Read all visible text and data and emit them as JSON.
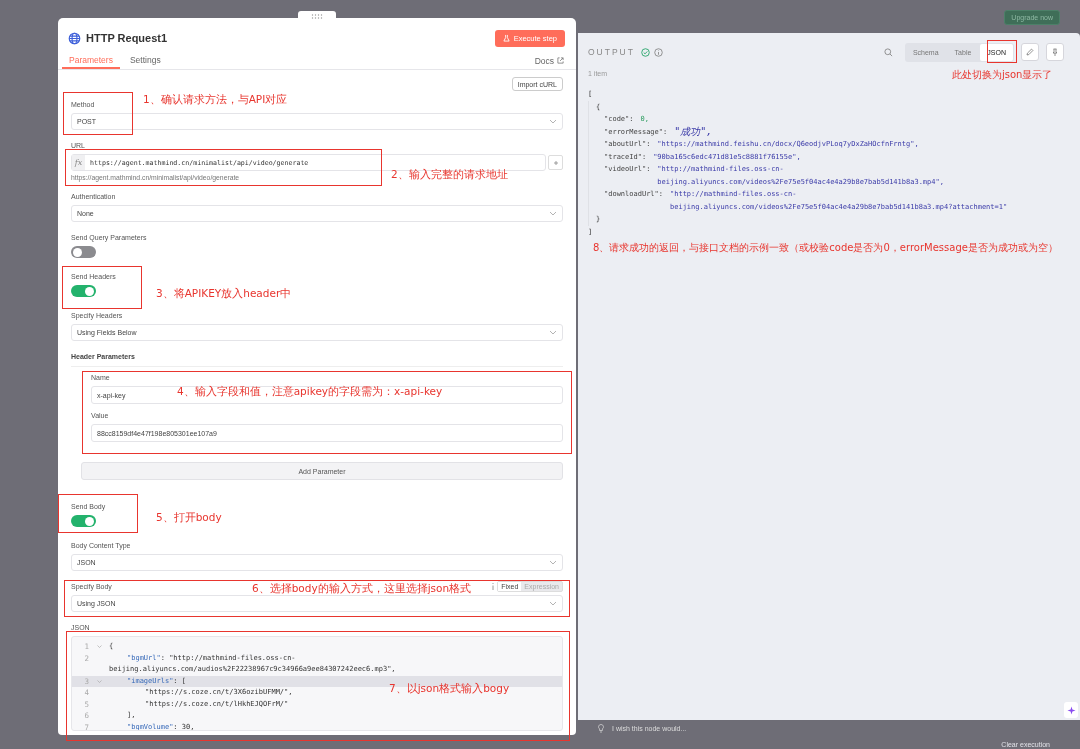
{
  "node_panel": {
    "title": "HTTP Request1",
    "execute_button": "Execute step",
    "tabs": [
      {
        "label": "Parameters",
        "selected": true
      },
      {
        "label": "Settings",
        "selected": false
      }
    ],
    "docs_link": "Docs",
    "import_button": "Import cURL",
    "fields": [
      {
        "kind": "select",
        "label": "Method",
        "value": "POST"
      },
      {
        "kind": "url",
        "label": "URL",
        "prefix": "fx",
        "value": "https://agent.mathmind.cn/minimalist/api/video/generate",
        "hint": "https://agent.mathmind.cn/minimalist/api/video/generate"
      },
      {
        "kind": "select",
        "label": "Authentication",
        "value": "None"
      },
      {
        "kind": "toggle",
        "label": "Send Query Parameters",
        "on": false
      },
      {
        "kind": "toggle",
        "label": "Send Headers",
        "on": true
      },
      {
        "kind": "select",
        "label": "Specify Headers",
        "value": "Using Fields Below"
      },
      {
        "kind": "collection",
        "label": "Header Parameters",
        "items": [
          {
            "label": "Name",
            "value": "x-api-key"
          },
          {
            "label": "Value",
            "value": "88cc8159df4e47f198e805301ee107a9"
          }
        ],
        "add_button": "Add Parameter"
      },
      {
        "kind": "toggle",
        "label": "Send Body",
        "on": true
      },
      {
        "kind": "select",
        "label": "Body Content Type",
        "value": "JSON"
      },
      {
        "kind": "select",
        "label": "Specify Body",
        "value": "Using JSON",
        "mode_options": [
          {
            "label": "Fixed",
            "selected": true
          },
          {
            "label": "Expression",
            "selected": false
          }
        ]
      },
      {
        "kind": "code",
        "label": "JSON",
        "rows": [
          {
            "number": "1",
            "foldable": true,
            "active": false,
            "kind": "top",
            "rest": "{"
          },
          {
            "number": "2",
            "foldable": false,
            "active": false,
            "kind": "inner",
            "key": "\"bgmUrl\"",
            "rest": ": \"http://mathmind-files.oss-cn-",
            "wrap": "beijing.aliyuncs.com/audios%2F22238967c9c34966a9ee84307242eec6.mp3\","
          },
          {
            "number": "3",
            "foldable": true,
            "active": true,
            "kind": "inner",
            "key": "\"imageUrls\"",
            "rest": ": ["
          },
          {
            "number": "4",
            "foldable": false,
            "active": false,
            "kind": "item",
            "rest": "\"https://s.coze.cn/t/3X6ozibUFMM/\","
          },
          {
            "number": "5",
            "foldable": false,
            "active": false,
            "kind": "item",
            "rest": "\"https://s.coze.cn/t/lHkhEJQOFrM/\""
          },
          {
            "number": "6",
            "foldable": false,
            "active": false,
            "kind": "inner",
            "rest": "],"
          },
          {
            "number": "7",
            "foldable": false,
            "active": false,
            "kind": "inner",
            "key": "\"bgmVolume\"",
            "rest": ": 30,"
          }
        ]
      }
    ]
  },
  "annotations_left": [
    "1、确认请求方法，与API对应",
    "2、输入完整的请求地址",
    "3、将APIKEY放入header中",
    "4、输入字段和值，注意apikey的字段需为：x-api-key",
    "5、打开body",
    "6、选择body的输入方式，这里选择json格式",
    "7、以json格式输入bogy"
  ],
  "upgrade_button": "Upgrade now",
  "output_panel": {
    "title": "OUTPUT",
    "views": [
      {
        "label": "Schema",
        "selected": false
      },
      {
        "label": "Table",
        "selected": false
      },
      {
        "label": "JSON",
        "selected": true
      }
    ],
    "count": "1 item",
    "rows": [
      {
        "kind": "outer",
        "text": "["
      },
      {
        "kind": "object",
        "text": "{"
      },
      {
        "kind": "pair",
        "key": "\"code\":",
        "numeric": true,
        "value_lines": [
          "0,"
        ]
      },
      {
        "kind": "pair",
        "key": "\"errorMessage\":",
        "numeric": false,
        "value_lines": [
          "\"成功\","
        ]
      },
      {
        "kind": "pair",
        "key": "\"aboutUrl\":",
        "numeric": false,
        "value_lines": [
          "\"https://mathmind.feishu.cn/docx/Q6eodjvPLoq7yDxZaHOcfnFrntg\","
        ]
      },
      {
        "kind": "pair",
        "key": "\"traceId\":",
        "numeric": false,
        "value_lines": [
          "\"90ba165c6edc471d81e5c8881f76155e\","
        ]
      },
      {
        "kind": "pair",
        "key": "\"videoUrl\":",
        "numeric": false,
        "value_lines": [
          "\"http://mathmind-files.oss-cn-",
          "beijing.aliyuncs.com/videos%2Fe75e5f04ac4e4a29b8e7bab5d141b8a3.mp4\","
        ]
      },
      {
        "kind": "pair",
        "key": "\"downloadUrl\":",
        "numeric": false,
        "value_lines": [
          "\"http://mathmind-files.oss-cn-",
          "beijing.aliyuncs.com/videos%2Fe75e5f04ac4e4a29b8e7bab5d141b8a3.mp4?attachment=1\""
        ]
      },
      {
        "kind": "object",
        "text": "}"
      },
      {
        "kind": "outer",
        "text": "]"
      }
    ]
  },
  "annotations_right": [
    "此处切换为json显示了",
    "8、请求成功的返回，与接口文档的示例一致（或校验code是否为0，errorMessage是否为成功或为空）"
  ],
  "feedback": "I wish this node would...",
  "clear_button": "Clear execution"
}
